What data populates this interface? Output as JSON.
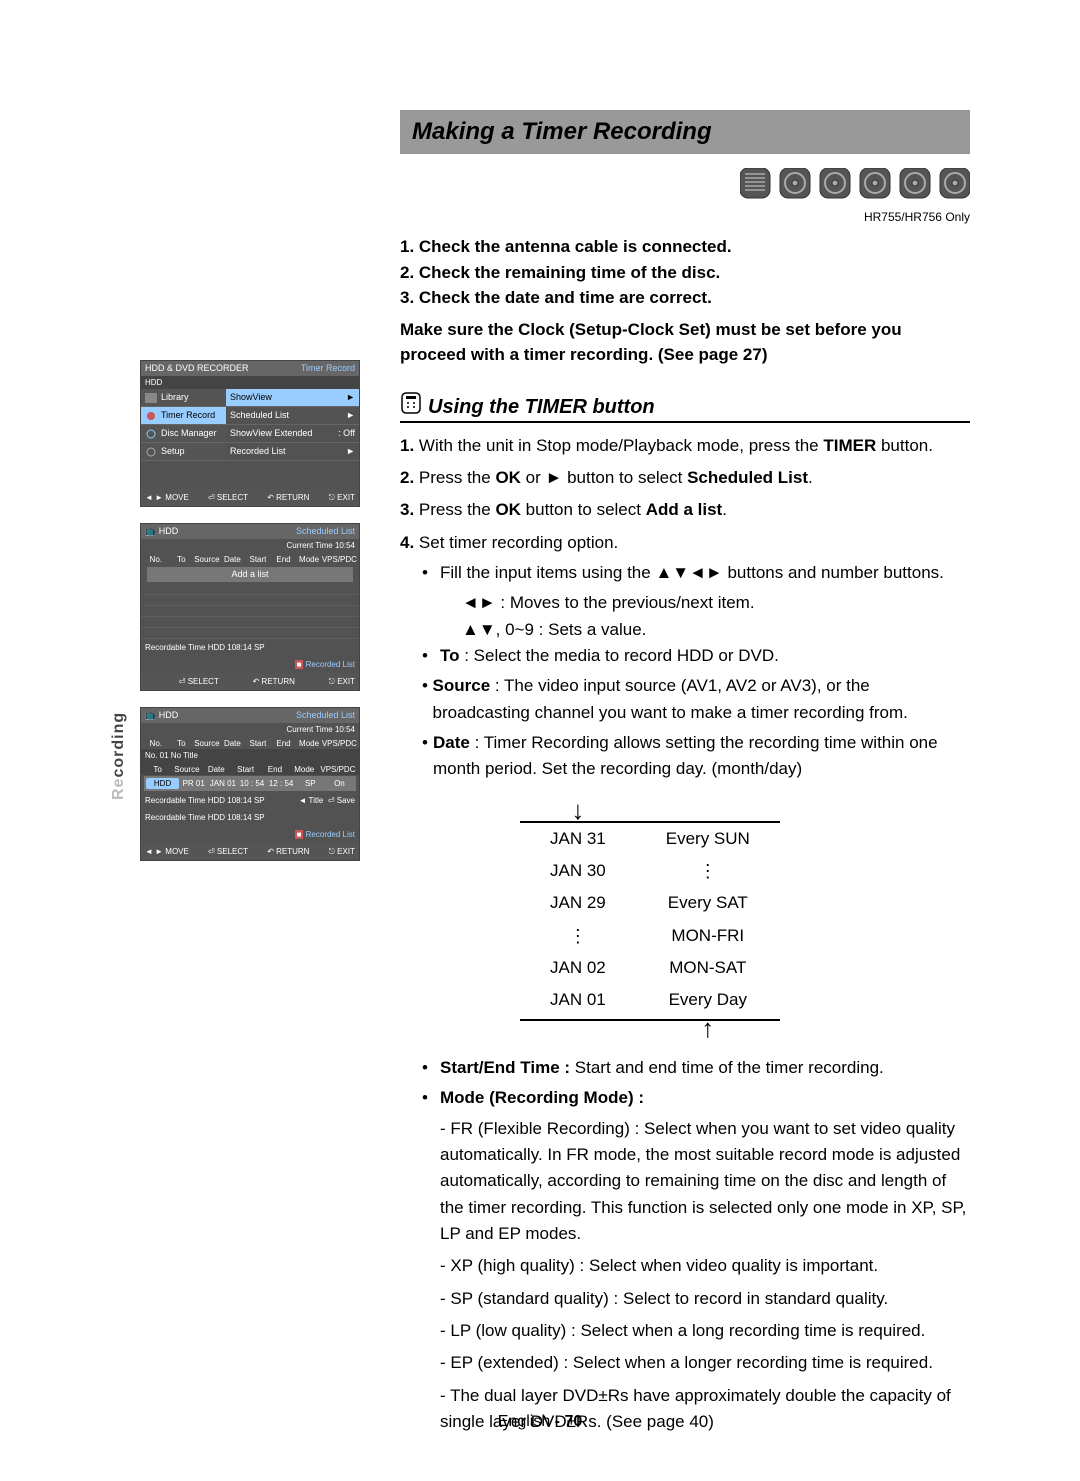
{
  "sidebar_tab": "Recording",
  "title": "Making a Timer Recording",
  "disc_labels": [
    "HDD",
    "DVD-RAM",
    "DVD-RW",
    "DVD-R",
    "DVD+RW",
    "DVD+R"
  ],
  "disc_note": "HR755/HR756 Only",
  "core_steps": [
    "1.  Check the antenna cable is connected.",
    "2.  Check the remaining time of the disc.",
    "3.  Check the date and time are correct."
  ],
  "core_note": "Make sure the Clock (Setup-Clock Set) must be set before you proceed with a timer recording. (See page 27)",
  "section_head": "Using the TIMER button",
  "step1_a": "With the unit in Stop mode/Playback mode, press the ",
  "step1_b": "TIMER",
  "step1_c": " button.",
  "step2_a": "Press the ",
  "step2_b": "OK",
  "step2_c": " or ► button to select ",
  "step2_d": "Scheduled List",
  "step2_e": ".",
  "step3_a": "Press the ",
  "step3_b": "OK",
  "step3_c": " button to select ",
  "step3_d": "Add a list",
  "step3_e": ".",
  "step4": "Set timer recording option.",
  "b1": "Fill the input items using the ▲▼◄► buttons and number buttons.",
  "b1a": "◄► : Moves to the previous/next item.",
  "b1b": "▲▼, 0~9 : Sets a value.",
  "b2_label": "To",
  "b2": " : Select the media to record HDD or DVD.",
  "b3_label": "Source",
  "b3": " : The video input source (AV1, AV2 or AV3), or the broadcasting channel you want to make a timer recording from.",
  "b4_label": "Date",
  "b4": " : Timer Recording allows setting the recording time within one month period. Set the recording day. (month/day)",
  "dates_left": [
    "JAN 31",
    "JAN 30",
    "JAN 29",
    "⋮",
    "JAN 02",
    "JAN 01"
  ],
  "dates_right": [
    "Every SUN",
    "⋮",
    "Every SAT",
    "MON-FRI",
    "MON-SAT",
    "Every Day"
  ],
  "b5_label": "Start/End Time :",
  "b5": " Start and end time of the timer recording.",
  "b6_label": "Mode (Recording Mode) :",
  "modes": [
    "- FR (Flexible Recording) : Select when you want to set video quality automatically. In FR mode, the most suitable record mode is adjusted automatically, according to remaining time on the disc and length of the timer recording. This function is selected only one mode in XP, SP, LP and EP modes.",
    "- XP (high quality) : Select when video quality is important.",
    "- SP (standard quality) : Select to record in standard quality.",
    "- LP (low quality) : Select when a long recording time is required.",
    "- EP (extended) : Select when a longer recording time is required.",
    "- The dual layer DVD±Rs have approximately double the capacity of single layer DVD±Rs. (See page 40)"
  ],
  "footer_a": "English ",
  "footer_b": "- 70",
  "mini1": {
    "title": "HDD & DVD RECORDER",
    "corner": "Timer Record",
    "hdd": "HDD",
    "side": [
      "Library",
      "Timer Record",
      "Disc Manager",
      "Setup"
    ],
    "menu": [
      [
        "ShowView",
        "►"
      ],
      [
        "Scheduled List",
        "►"
      ],
      [
        "ShowView Extended",
        ": Off"
      ],
      [
        "Recorded List",
        "►"
      ]
    ],
    "nav": [
      "◄ ► MOVE",
      "⏎ SELECT",
      "↶ RETURN",
      "⎋ EXIT"
    ]
  },
  "mini2": {
    "hdd": "HDD",
    "corner": "Scheduled List",
    "currenttime": "Current Time 10:54",
    "headers": [
      "No.",
      "To",
      "Source",
      "Date",
      "Start",
      "End",
      "Mode",
      "VPS/PDC"
    ],
    "addlist": "Add a list",
    "rectime": "Recordable Time  HDD  108:14 SP",
    "reclist": "Recorded List",
    "nav": [
      "⏎ SELECT",
      "↶ RETURN",
      "⎋ EXIT"
    ]
  },
  "mini3": {
    "hdd": "HDD",
    "corner": "Scheduled List",
    "currenttime": "Current Time 10:54",
    "headers": [
      "No.",
      "To",
      "Source",
      "Date",
      "Start",
      "End",
      "Mode",
      "VPS/PDC"
    ],
    "notitle": "No. 01 No Title",
    "headers2": [
      "To",
      "Source",
      "Date",
      "Start",
      "End",
      "Mode",
      "VPS/PDC"
    ],
    "row": [
      "HDD",
      "PR 01",
      "JAN 01",
      "10 : 54",
      "12 : 54",
      "SP",
      "On"
    ],
    "rectime": "Recordable Time  HDD  108:14 SP",
    "title_btn": "◄ Title",
    "save_btn": "⏎ Save",
    "rectime2": "Recordable Time  HDD  108:14 SP",
    "reclist": "Recorded List",
    "nav": [
      "◄ ► MOVE",
      "⏎ SELECT",
      "↶ RETURN",
      "⎋ EXIT"
    ]
  }
}
